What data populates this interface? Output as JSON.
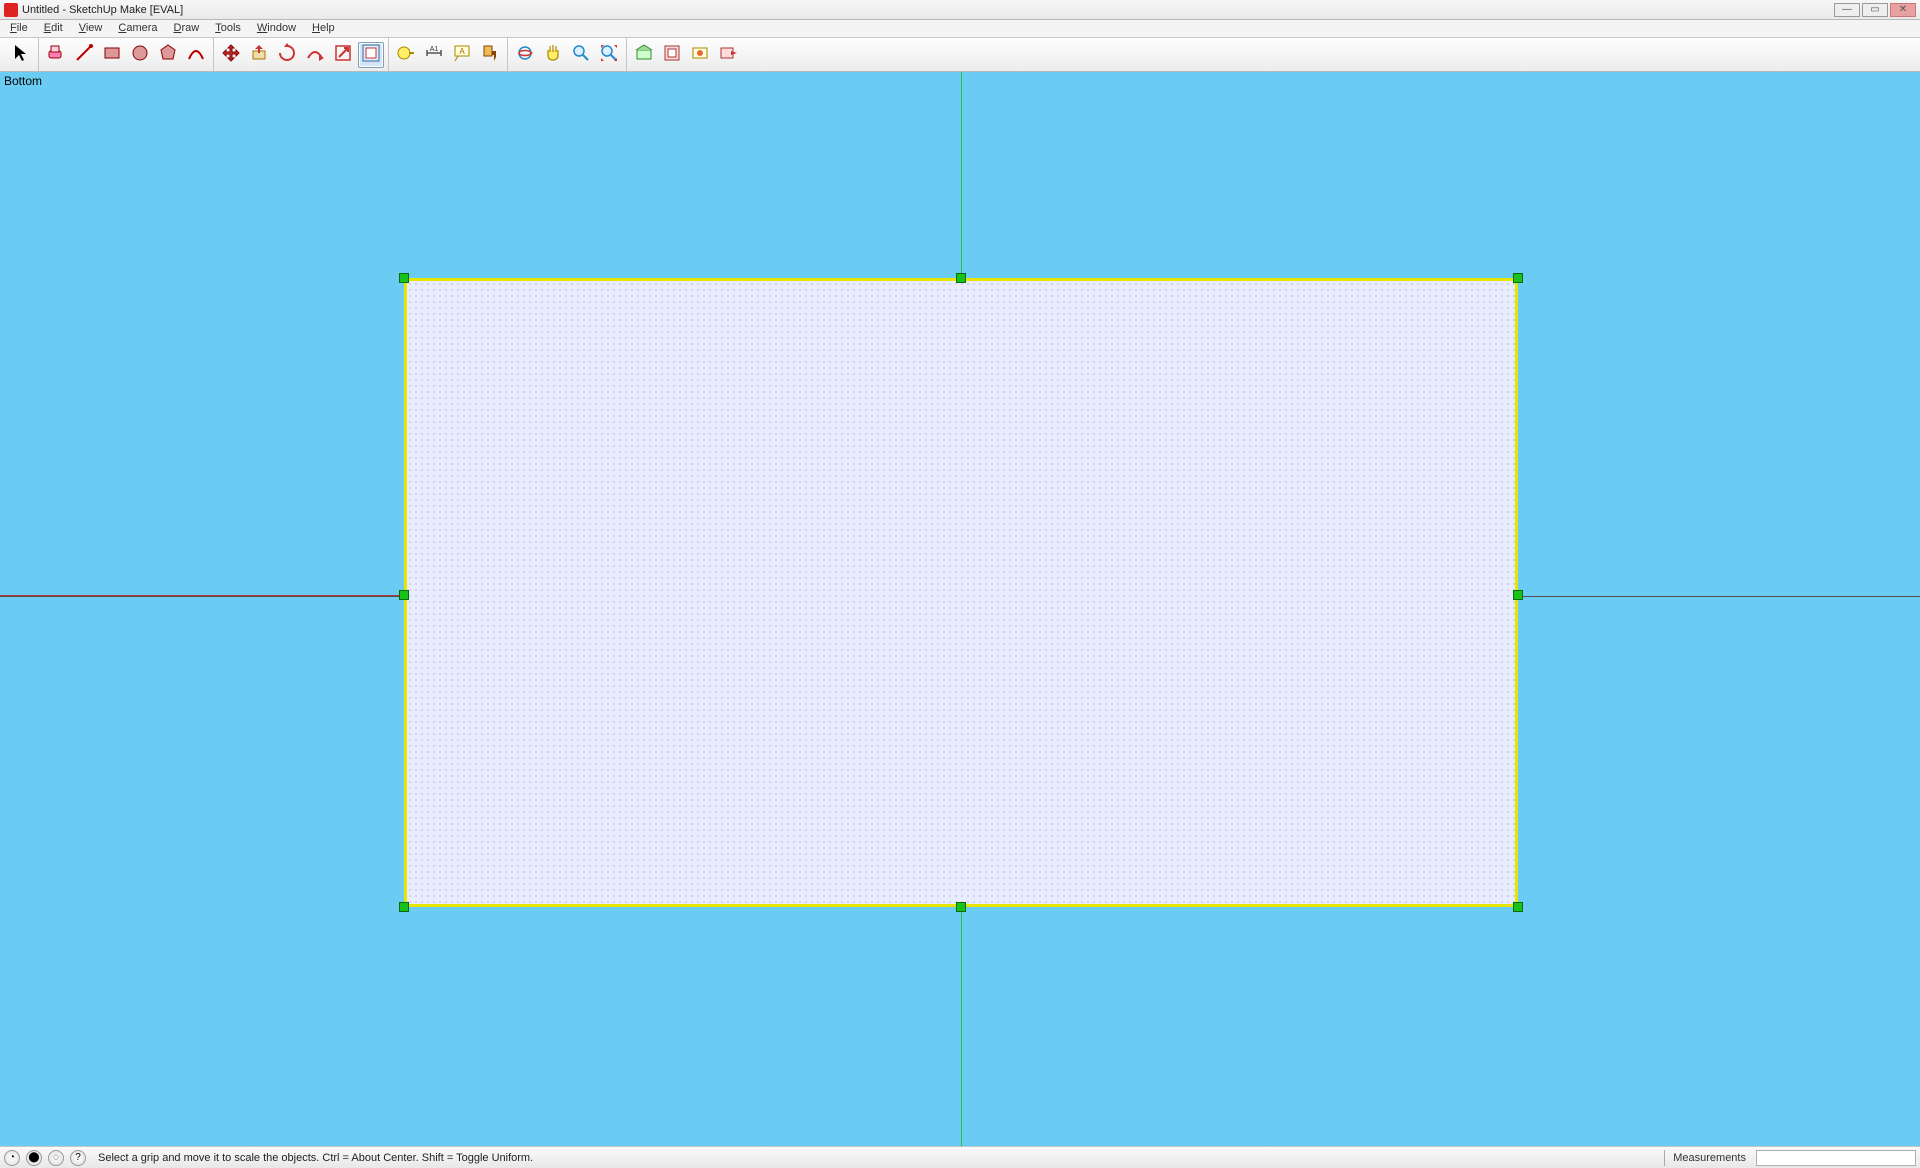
{
  "titlebar": {
    "title": "Untitled - SketchUp Make [EVAL]",
    "min_tip": "Minimize",
    "max_tip": "Maximize",
    "close_tip": "Close"
  },
  "menubar": [
    "File",
    "Edit",
    "View",
    "Camera",
    "Draw",
    "Tools",
    "Window",
    "Help"
  ],
  "toolbar_groups": [
    [
      "select"
    ],
    [
      "eraser",
      "line",
      "rectangle",
      "circle",
      "polygon",
      "arc"
    ],
    [
      "move",
      "pushpull",
      "rotate",
      "follow-me",
      "scale",
      "offset"
    ],
    [
      "tape",
      "dimension",
      "text",
      "paint"
    ],
    [
      "orbit",
      "pan",
      "zoom",
      "zoom-extents"
    ],
    [
      "warehouse",
      "components",
      "extensions",
      "send"
    ]
  ],
  "toolbar_selected": "offset",
  "viewport": {
    "label": "Bottom"
  },
  "statusbar": {
    "hint": "Select a grip and move it to scale the objects. Ctrl = About Center. Shift = Toggle Uniform.",
    "measure_label": "Measurements",
    "measure_value": ""
  }
}
